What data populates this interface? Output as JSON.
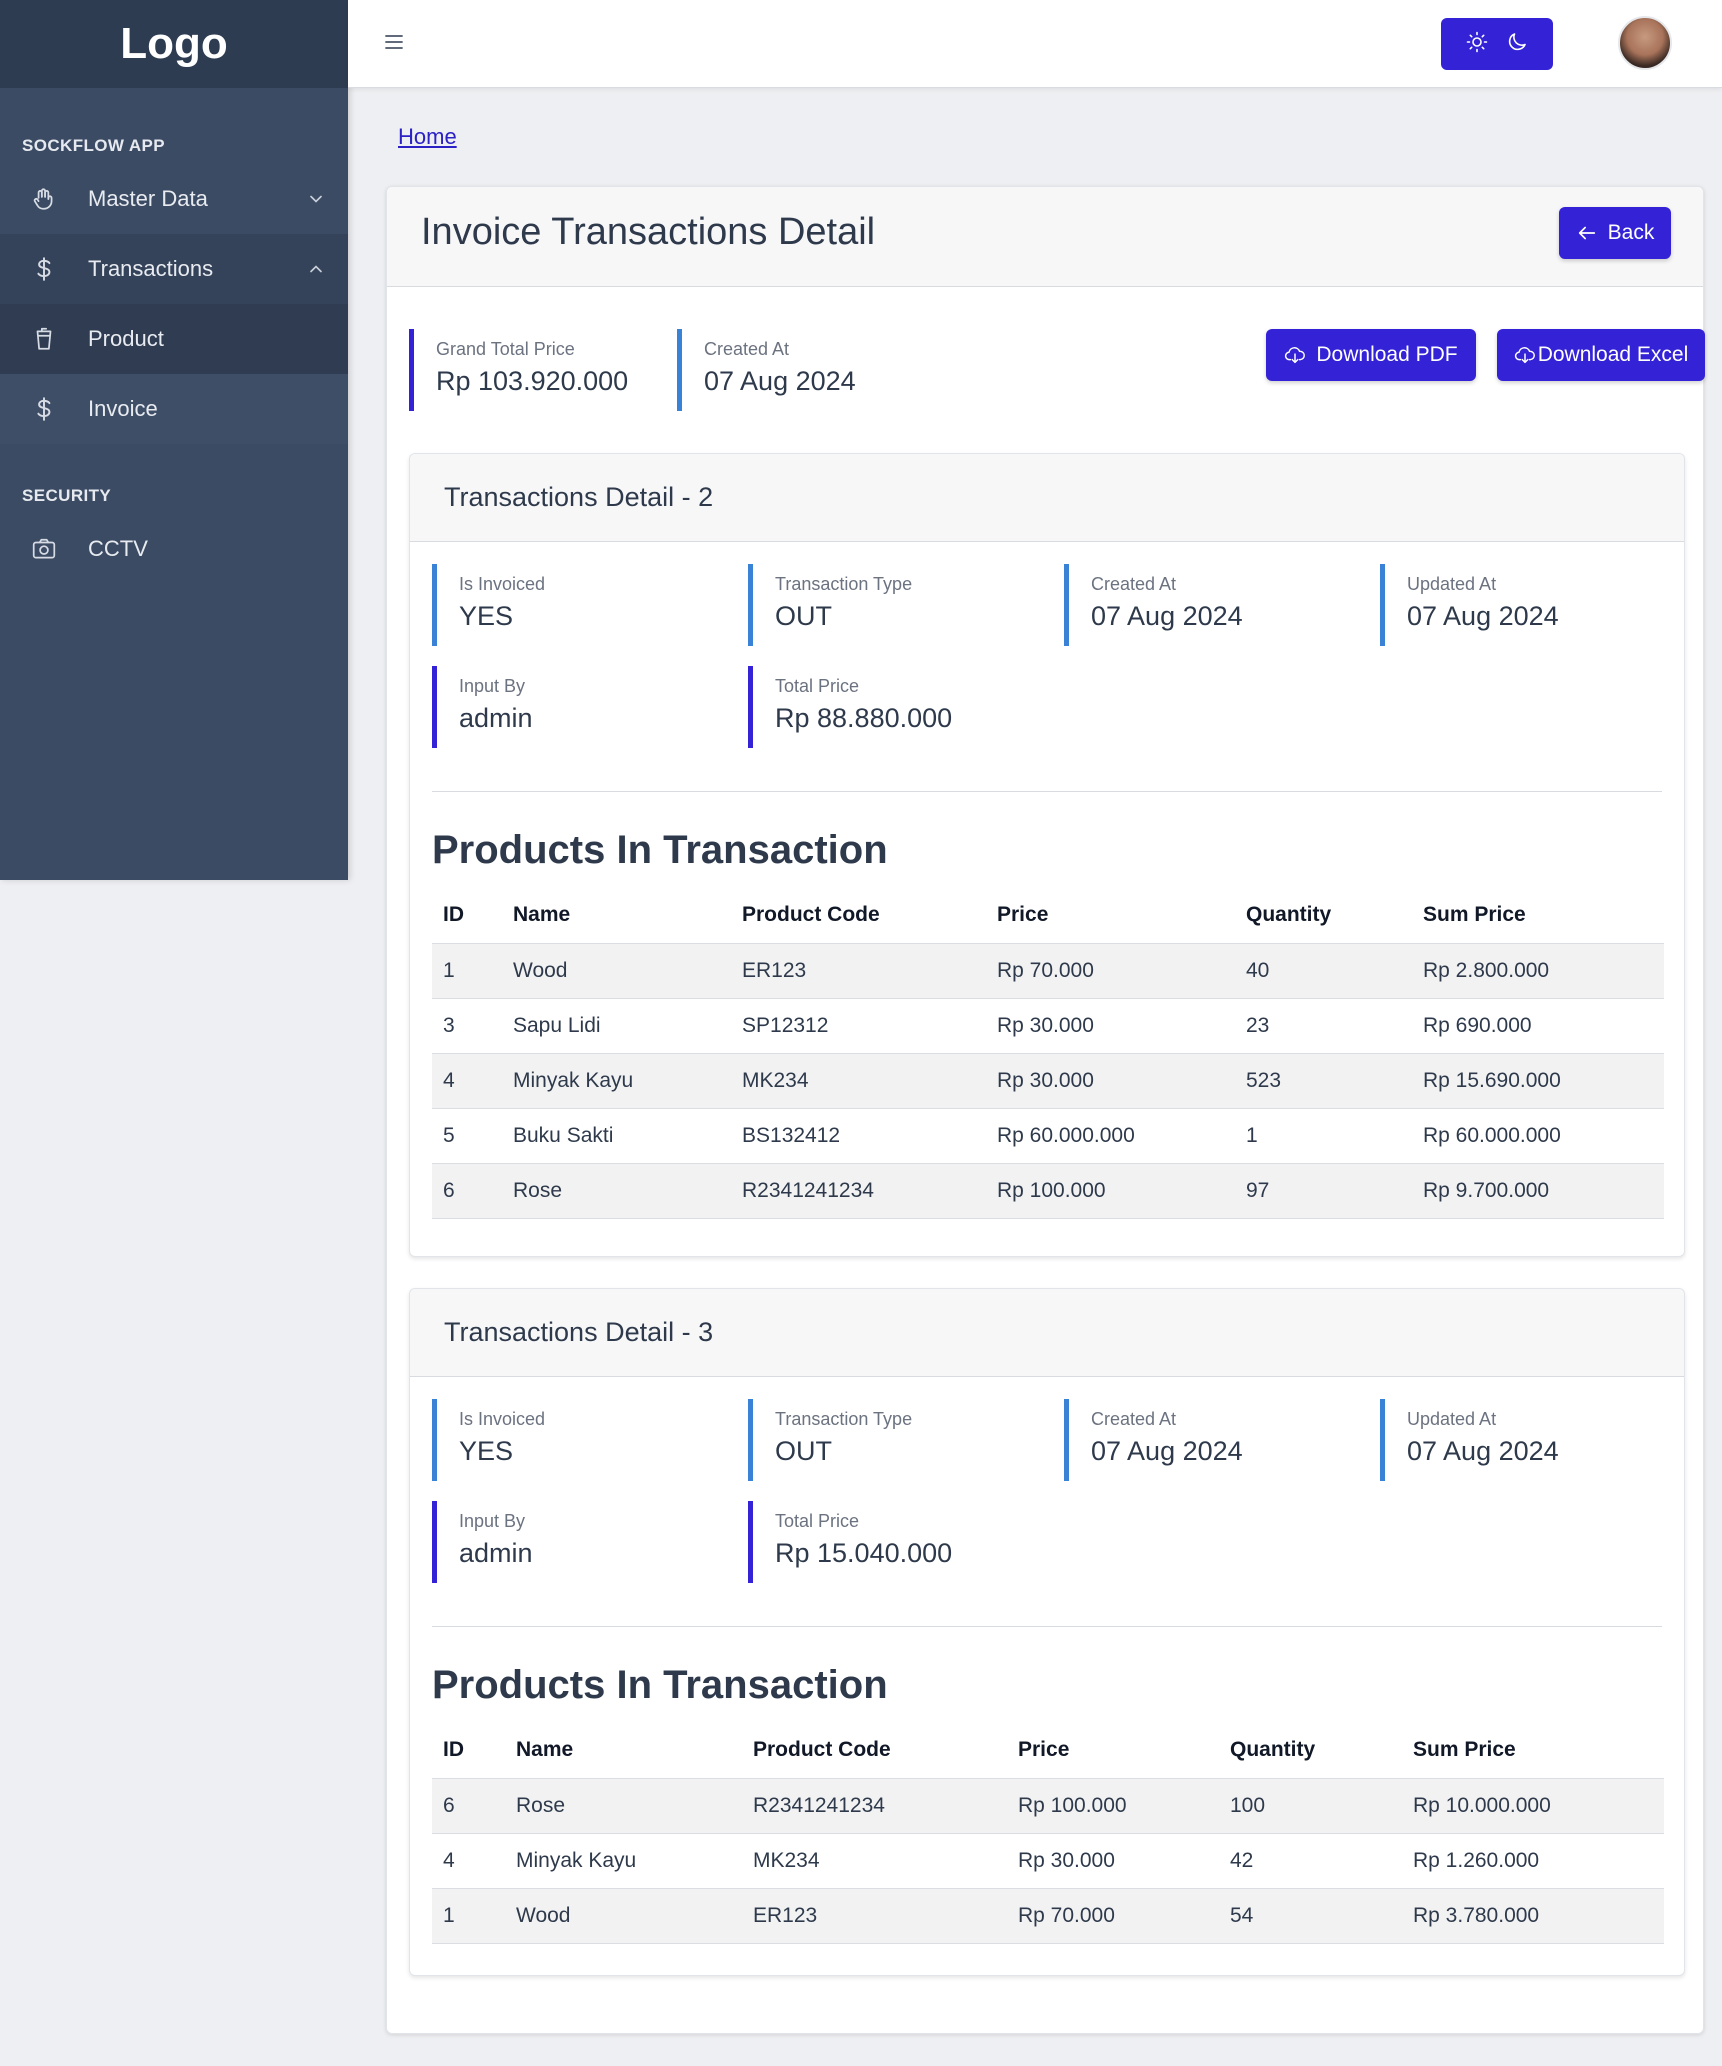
{
  "sidebar": {
    "brand": "Logo",
    "section_app": "SOCKFLOW APP",
    "section_security": "SECURITY",
    "items": [
      {
        "label": "Master Data",
        "icon": "hand-icon"
      },
      {
        "label": "Transactions",
        "icon": "dollar-icon"
      },
      {
        "label": "Product",
        "icon": "cup-icon"
      },
      {
        "label": "Invoice",
        "icon": "dollar-icon"
      },
      {
        "label": "CCTV",
        "icon": "camera-icon"
      }
    ]
  },
  "header": {
    "menu_icon": "hamburger-icon",
    "theme_light_icon": "sun-icon",
    "theme_dark_icon": "moon-icon"
  },
  "breadcrumb": "Home",
  "page": {
    "title": "Invoice Transactions Detail",
    "back_label": "Back",
    "grand_total_label": "Grand Total Price",
    "grand_total_value": "Rp 103.920.000",
    "created_label": "Created At",
    "created_value": "07 Aug 2024",
    "download_pdf": "Download PDF",
    "download_excel": "Download Excel"
  },
  "transactions": [
    {
      "title": "Transactions Detail - 2",
      "is_invoiced_label": "Is Invoiced",
      "is_invoiced": "YES",
      "type_label": "Transaction Type",
      "type": "OUT",
      "created_label": "Created At",
      "created": "07 Aug 2024",
      "updated_label": "Updated At",
      "updated": "07 Aug 2024",
      "input_by_label": "Input By",
      "input_by": "admin",
      "total_label": "Total Price",
      "total": "Rp 88.880.000",
      "products_title": "Products In Transaction",
      "columns": [
        "ID",
        "Name",
        "Product Code",
        "Price",
        "Quantity",
        "Sum Price"
      ],
      "rows": [
        [
          "1",
          "Wood",
          "ER123",
          "Rp 70.000",
          "40",
          "Rp 2.800.000"
        ],
        [
          "3",
          "Sapu Lidi",
          "SP12312",
          "Rp 30.000",
          "23",
          "Rp 690.000"
        ],
        [
          "4",
          "Minyak Kayu",
          "MK234",
          "Rp 30.000",
          "523",
          "Rp 15.690.000"
        ],
        [
          "5",
          "Buku Sakti",
          "BS132412",
          "Rp 60.000.000",
          "1",
          "Rp 60.000.000"
        ],
        [
          "6",
          "Rose",
          "R2341241234",
          "Rp 100.000",
          "97",
          "Rp 9.700.000"
        ]
      ]
    },
    {
      "title": "Transactions Detail - 3",
      "is_invoiced_label": "Is Invoiced",
      "is_invoiced": "YES",
      "type_label": "Transaction Type",
      "type": "OUT",
      "created_label": "Created At",
      "created": "07 Aug 2024",
      "updated_label": "Updated At",
      "updated": "07 Aug 2024",
      "input_by_label": "Input By",
      "input_by": "admin",
      "total_label": "Total Price",
      "total": "Rp 15.040.000",
      "products_title": "Products In Transaction",
      "columns": [
        "ID",
        "Name",
        "Product Code",
        "Price",
        "Quantity",
        "Sum Price"
      ],
      "rows": [
        [
          "6",
          "Rose",
          "R2341241234",
          "Rp 100.000",
          "100",
          "Rp 10.000.000"
        ],
        [
          "4",
          "Minyak Kayu",
          "MK234",
          "Rp 30.000",
          "42",
          "Rp 1.260.000"
        ],
        [
          "1",
          "Wood",
          "ER123",
          "Rp 70.000",
          "54",
          "Rp 3.780.000"
        ]
      ]
    }
  ],
  "colors": {
    "primary": "#3322d6",
    "sidebar": "#3c4b64",
    "accent_blue": "#3a82d6"
  }
}
